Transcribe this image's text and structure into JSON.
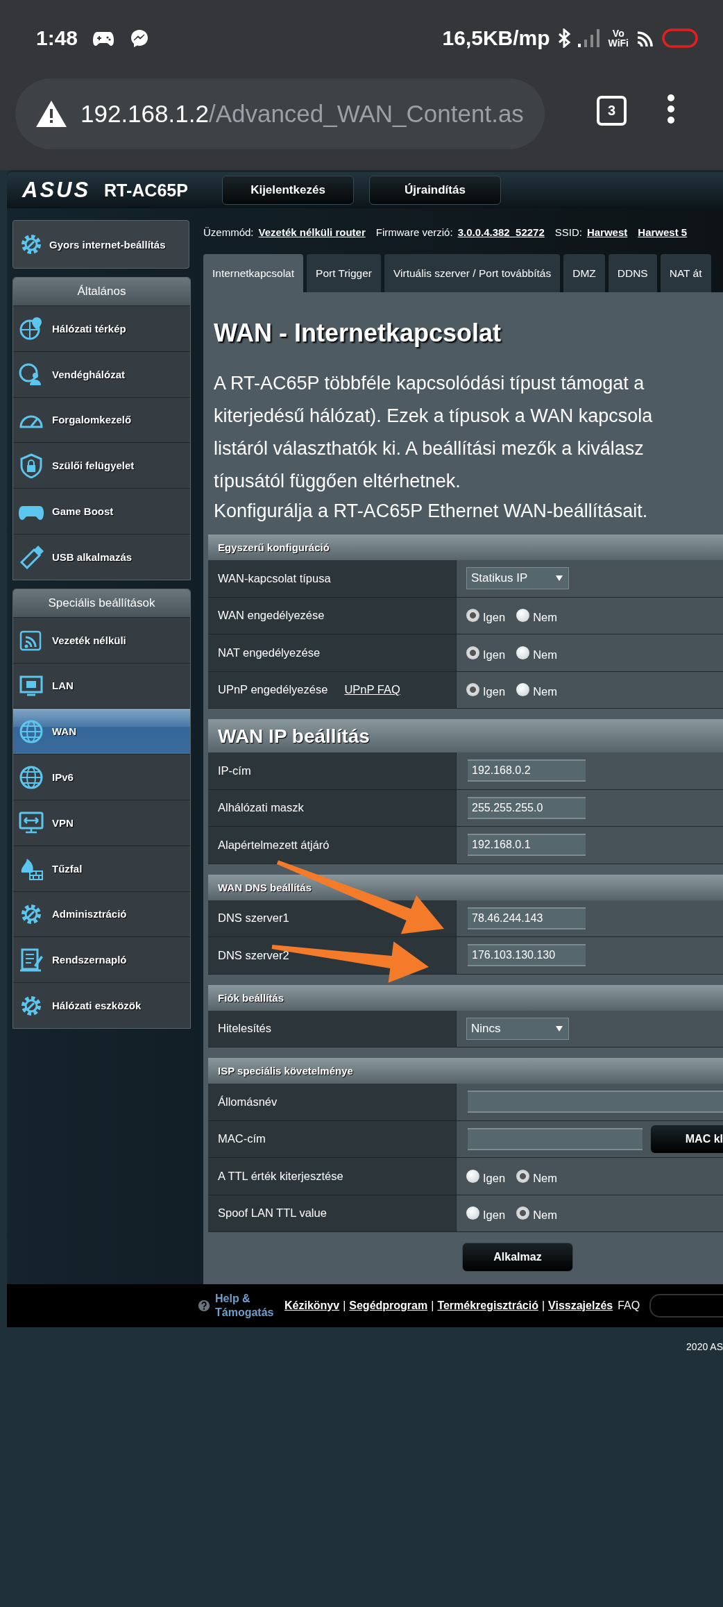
{
  "status_bar": {
    "time": "1:48",
    "net_speed": "16,5KB/mp",
    "vowifi": [
      "Vo",
      "WiFi"
    ]
  },
  "browser": {
    "url_host": "192.168.1.2",
    "url_path": "/Advanced_WAN_Content.as",
    "tab_count": "3"
  },
  "router_header": {
    "brand": "ASUS",
    "model": "RT-AC65P",
    "buttons": [
      "Kijelentkezés",
      "Újraindítás"
    ]
  },
  "info_bar": [
    {
      "label": "Üzemmód:",
      "value": "Vezeték nélküli router"
    },
    {
      "label": "Firmware verzió:",
      "value": "3.0.0.4.382_52272"
    },
    {
      "label": "SSID:",
      "value": "Harwest"
    },
    {
      "value": "Harwest 5"
    }
  ],
  "sidebar": {
    "quick_setup": "Gyors internet-beállítás",
    "groups": [
      {
        "title": "Általános",
        "items": [
          {
            "label": "Hálózati térkép",
            "selected": false
          },
          {
            "label": "Vendéghálózat",
            "selected": false
          },
          {
            "label": "Forgalomkezelő",
            "selected": false
          },
          {
            "label": "Szülői felügyelet",
            "selected": false
          },
          {
            "label": "Game Boost",
            "selected": false
          },
          {
            "label": "USB alkalmazás",
            "selected": false
          }
        ]
      },
      {
        "title": "Speciális beállítások",
        "items": [
          {
            "label": "Vezeték nélküli",
            "selected": false
          },
          {
            "label": "LAN",
            "selected": false
          },
          {
            "label": "WAN",
            "selected": true
          },
          {
            "label": "IPv6",
            "selected": false
          },
          {
            "label": "VPN",
            "selected": false
          },
          {
            "label": "Tűzfal",
            "selected": false
          },
          {
            "label": "Adminisztráció",
            "selected": false
          },
          {
            "label": "Rendszernapló",
            "selected": false
          },
          {
            "label": "Hálózati eszközök",
            "selected": false
          }
        ]
      }
    ]
  },
  "tabs": [
    {
      "label": "Internetkapcsolat",
      "selected": true
    },
    {
      "label": "Port Trigger",
      "selected": false
    },
    {
      "label": "Virtuális szerver / Port továbbítás",
      "selected": false
    },
    {
      "label": "DMZ",
      "selected": false
    },
    {
      "label": "DDNS",
      "selected": false
    },
    {
      "label": "NAT át",
      "selected": false
    }
  ],
  "title": "WAN - Internetkapcsolat",
  "description_lines": [
    "A RT-AC65P többféle kapcsolódási típust támogat a",
    "kiterjedésű hálózat). Ezek a típusok a WAN kapcsola",
    "listáról választhatók ki. A beállítási mezők a kiválasz",
    "típusától függően eltérhetnek."
  ],
  "subtitle": "Konfigurálja a RT-AC65P Ethernet WAN-beállításait.",
  "sections": [
    {
      "title": "Egyszerű konfiguráció",
      "kind": "small",
      "rows": [
        {
          "kind": "select",
          "label": "WAN-kapcsolat típusa",
          "value": "Statikus IP"
        },
        {
          "kind": "radio",
          "label": "WAN engedélyezése",
          "options": [
            {
              "label": "Igen",
              "selected": true
            },
            {
              "label": "Nem",
              "selected": false
            }
          ]
        },
        {
          "kind": "radio",
          "label": "NAT engedélyezése",
          "options": [
            {
              "label": "Igen",
              "selected": true
            },
            {
              "label": "Nem",
              "selected": false
            }
          ]
        },
        {
          "kind": "radio",
          "label": "UPnP engedélyezése",
          "link": "UPnP FAQ",
          "options": [
            {
              "label": "Igen",
              "selected": true
            },
            {
              "label": "Nem",
              "selected": false
            }
          ]
        }
      ]
    },
    {
      "title": "WAN IP beállítás",
      "kind": "large",
      "rows": [
        {
          "kind": "input",
          "label": "IP-cím",
          "value": "192.168.0.2"
        },
        {
          "kind": "input",
          "label": "Alhálózati maszk",
          "value": "255.255.255.0"
        },
        {
          "kind": "input",
          "label": "Alapértelmezett átjáró",
          "value": "192.168.0.1"
        }
      ]
    },
    {
      "title": "WAN DNS beállítás",
      "kind": "small",
      "rows": [
        {
          "kind": "input",
          "label": "DNS szerver1",
          "value": "78.46.244.143"
        },
        {
          "kind": "input",
          "label": "DNS szerver2",
          "value": "176.103.130.130"
        }
      ]
    },
    {
      "title": "Fiók beállítás",
      "kind": "small",
      "rows": [
        {
          "kind": "select",
          "label": "Hitelesítés",
          "value": "Nincs"
        }
      ]
    },
    {
      "title": "ISP speciális követelménye",
      "kind": "small",
      "rows": [
        {
          "kind": "wide_input",
          "label": "Állomásnév"
        },
        {
          "kind": "input_button",
          "label": "MAC-cím",
          "button": "MAC kl"
        },
        {
          "kind": "radio",
          "label": "A TTL érték kiterjesztése",
          "options": [
            {
              "label": "Igen",
              "selected": false
            },
            {
              "label": "Nem",
              "selected": true
            }
          ]
        },
        {
          "kind": "radio",
          "label": "Spoof LAN TTL value",
          "options": [
            {
              "label": "Igen",
              "selected": false
            },
            {
              "label": "Nem",
              "selected": true
            }
          ]
        }
      ]
    }
  ],
  "apply_button": "Alkalmaz",
  "annotations": [
    {
      "kind": "arrow"
    },
    {
      "kind": "arrow"
    }
  ],
  "footer": {
    "help": [
      "Help &",
      "Támogatás"
    ],
    "links": [
      "Kézikönyv",
      "Segédprogram",
      "Termékregisztráció",
      "Visszajelzés"
    ],
    "separator": "|",
    "faq": "FAQ"
  },
  "copyright": "2020 AS"
}
